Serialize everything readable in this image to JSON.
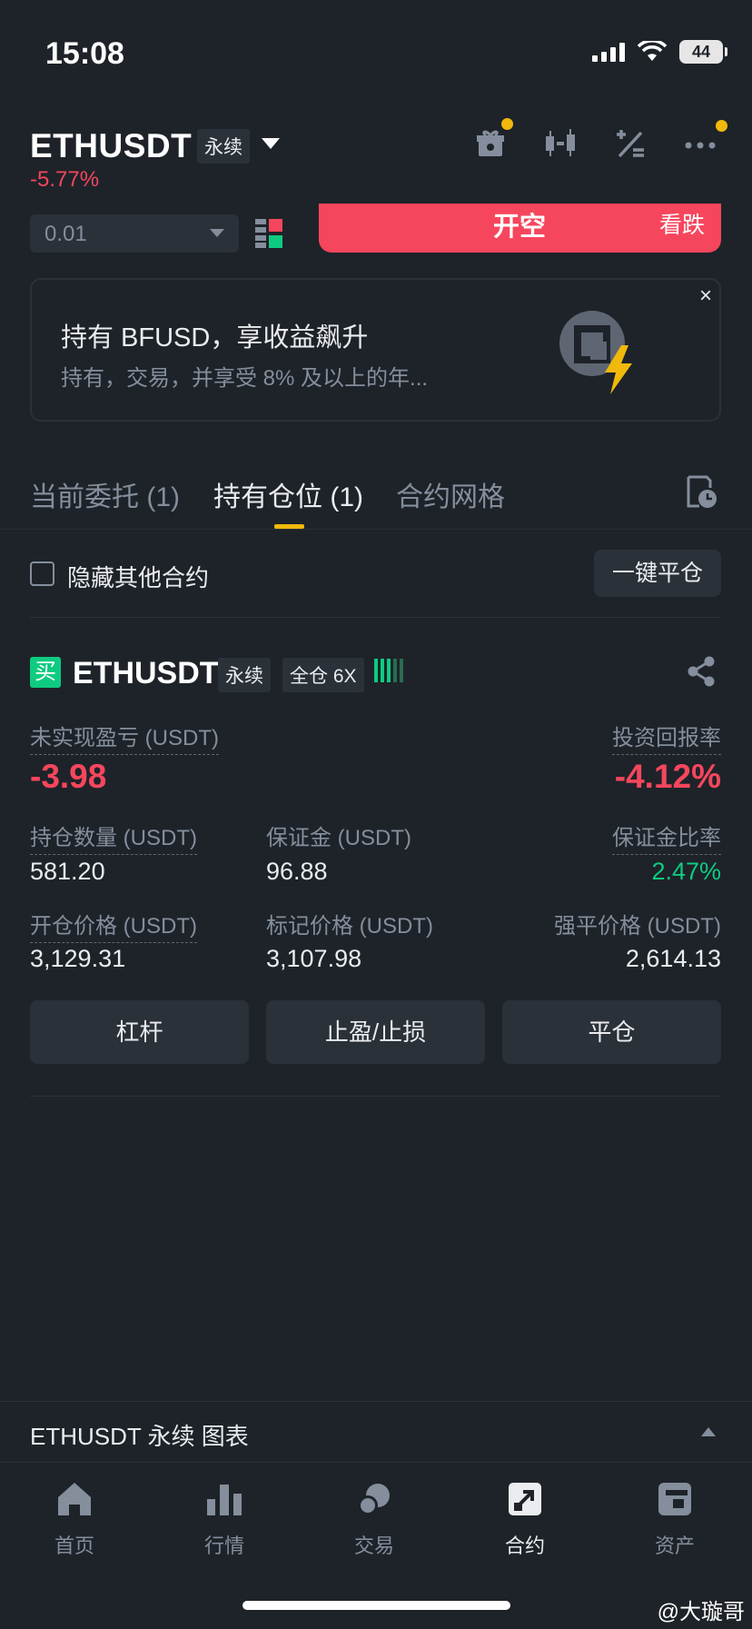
{
  "status_bar": {
    "time": "15:08",
    "battery": "44"
  },
  "header": {
    "symbol": "ETHUSDT",
    "contract_type": "永续",
    "change_pct": "-5.77%"
  },
  "order": {
    "quantity": "0.01",
    "short_button": {
      "label": "开空",
      "sub_label": "看跌"
    }
  },
  "promo": {
    "title": "持有 BFUSD，享收益飙升",
    "subtitle": "持有，交易，并享受 8% 及以上的年...",
    "close": "×"
  },
  "tabs": [
    {
      "label": "当前委托 (1)"
    },
    {
      "label": "持有仓位 (1)"
    },
    {
      "label": "合约网格"
    }
  ],
  "filter": {
    "hide_other_label": "隐藏其他合约",
    "close_all_label": "一键平仓"
  },
  "position": {
    "side_badge": "买",
    "symbol": "ETHUSDT",
    "contract_type": "永续",
    "margin_mode": "全仓 6X",
    "unrealized_pnl_label": "未实现盈亏 (USDT)",
    "unrealized_pnl": "-3.98",
    "roe_label": "投资回报率",
    "roe": "-4.12%",
    "size_label": "持仓数量 (USDT)",
    "size": "581.20",
    "margin_label": "保证金 (USDT)",
    "margin": "96.88",
    "margin_ratio_label": "保证金比率",
    "margin_ratio": "2.47%",
    "entry_label": "开仓价格 (USDT)",
    "entry": "3,129.31",
    "mark_label": "标记价格 (USDT)",
    "mark": "3,107.98",
    "liq_label": "强平价格 (USDT)",
    "liq": "2,614.13",
    "buttons": {
      "leverage": "杠杆",
      "tpsl": "止盈/止损",
      "close": "平仓"
    }
  },
  "chart_bar": {
    "label": "ETHUSDT 永续  图表"
  },
  "nav": [
    {
      "label": "首页",
      "icon": "home-icon"
    },
    {
      "label": "行情",
      "icon": "markets-icon"
    },
    {
      "label": "交易",
      "icon": "trade-icon"
    },
    {
      "label": "合约",
      "icon": "futures-icon"
    },
    {
      "label": "资产",
      "icon": "wallet-icon"
    }
  ],
  "watermark": "@大璇哥",
  "colors": {
    "background": "#1e2329",
    "red": "#f6465d",
    "green": "#0ecb81",
    "accent": "#f0b90b",
    "panel": "#2b3139"
  }
}
